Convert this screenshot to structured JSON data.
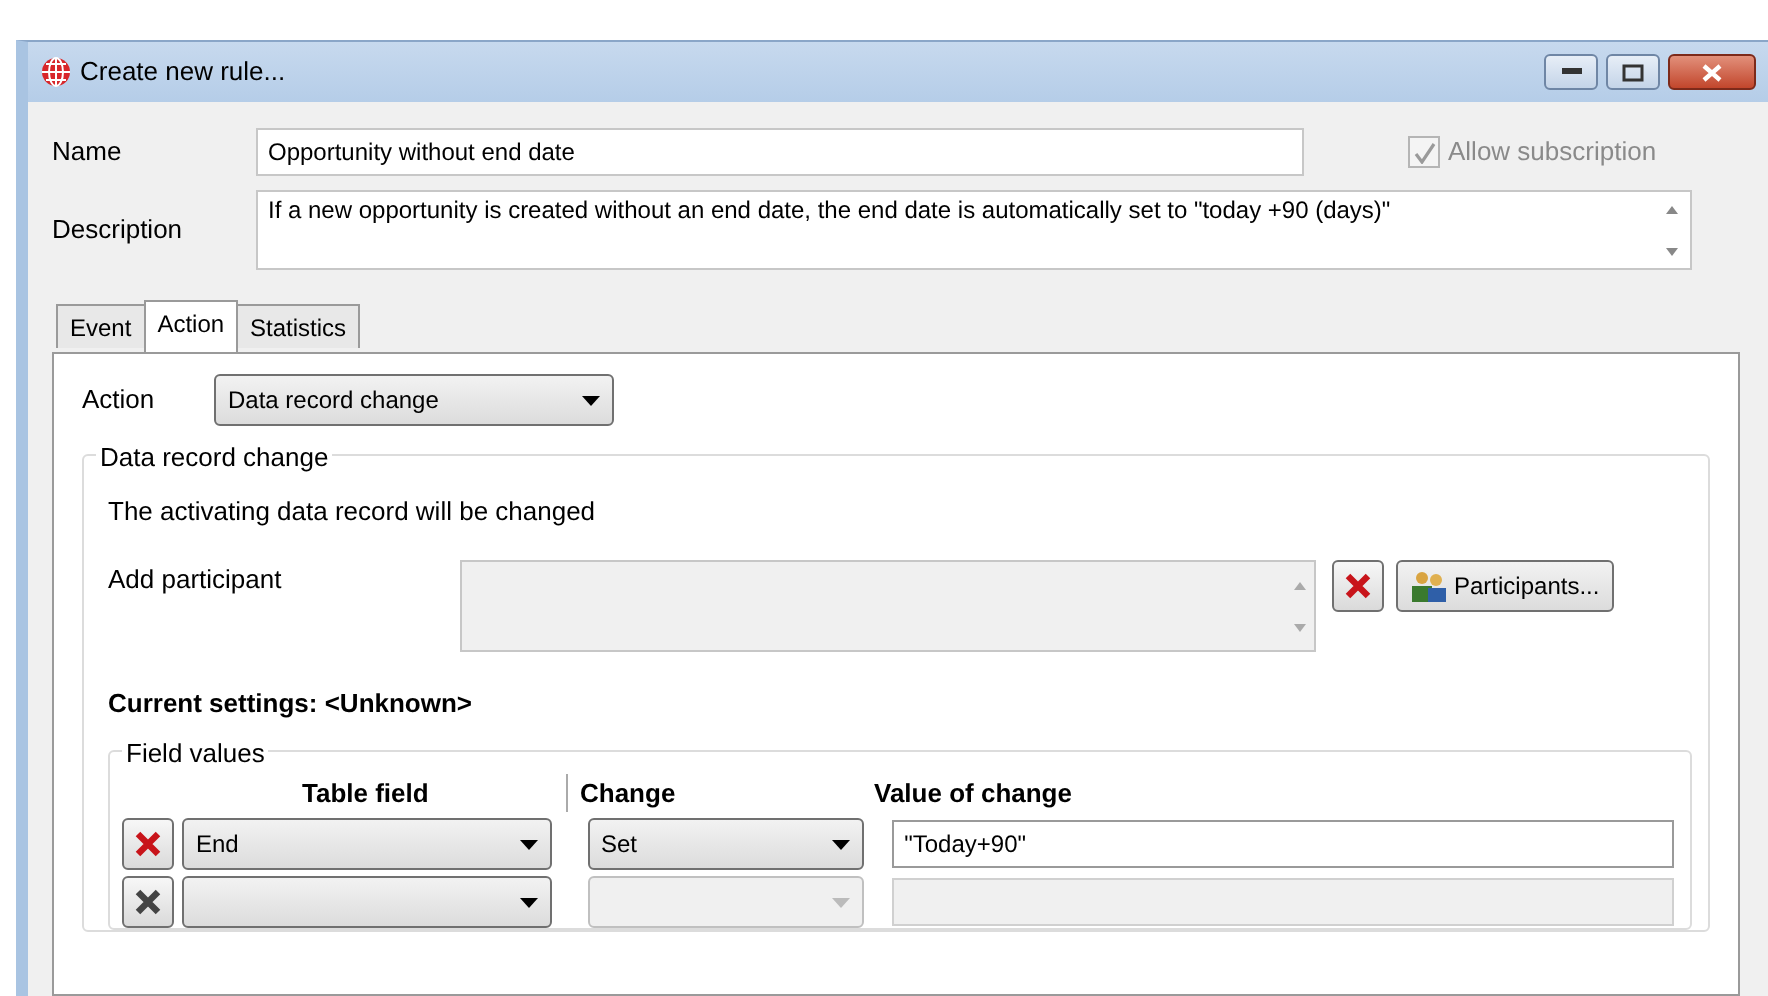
{
  "window": {
    "title": "Create new rule..."
  },
  "name": {
    "label": "Name",
    "value": "Opportunity without end date"
  },
  "allow_subscription": {
    "label": "Allow subscription",
    "checked": true,
    "disabled": true
  },
  "description": {
    "label": "Description",
    "value": "If a new opportunity is created without an end date, the end date is automatically set to \"today +90 (days)\""
  },
  "tabs": [
    {
      "label": "Event",
      "selected": false
    },
    {
      "label": "Action",
      "selected": true
    },
    {
      "label": "Statistics",
      "selected": false
    }
  ],
  "action": {
    "label": "Action",
    "value": "Data record change"
  },
  "group": {
    "title": "Data record change",
    "info": "The activating data record will be changed",
    "participant_label": "Add participant",
    "participants_button": "Participants...",
    "current_settings": "Current settings: <Unknown>"
  },
  "field_values": {
    "title": "Field values",
    "columns": [
      "Table field",
      "Change",
      "Value of change"
    ],
    "rows": [
      {
        "table_field": "End",
        "change": "Set",
        "value": "\"Today+90\"",
        "disabled": false
      },
      {
        "disabled": true
      }
    ]
  }
}
